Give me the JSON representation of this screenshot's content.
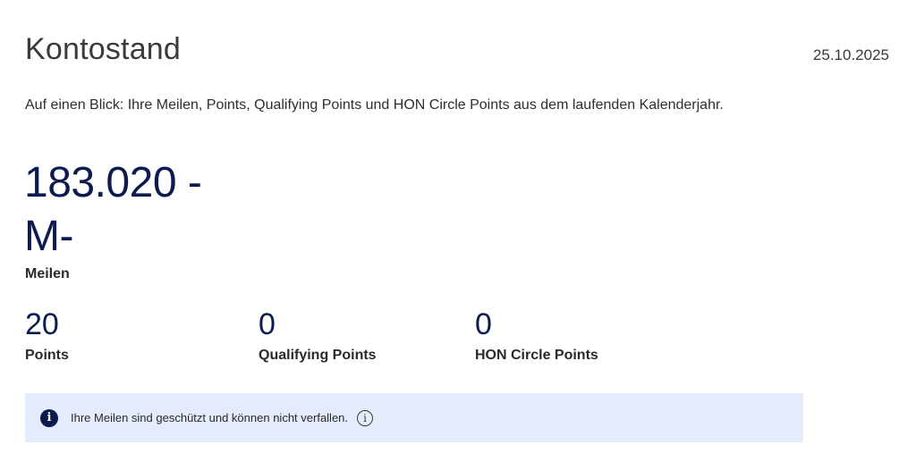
{
  "header": {
    "title": "Kontostand",
    "date": "25.10.2025",
    "subtitle": "Auf einen Blick: Ihre Meilen, Points, Qualifying Points und HON Circle Points aus dem laufenden Kalenderjahr."
  },
  "miles": {
    "value": "183.020 - M-",
    "label": "Meilen"
  },
  "stats": [
    {
      "value": "20",
      "label": "Points"
    },
    {
      "value": "0",
      "label": "Qualifying Points"
    },
    {
      "value": "0",
      "label": "HON Circle Points"
    }
  ],
  "info": {
    "icon": "info-icon",
    "text": "Ihre Meilen sind geschützt und können nicht verfallen.",
    "tooltip_icon": "info-outline-icon",
    "icon_glyph": "i"
  },
  "colors": {
    "accent": "#0b1b4f",
    "banner_bg": "#e4ecfb"
  }
}
